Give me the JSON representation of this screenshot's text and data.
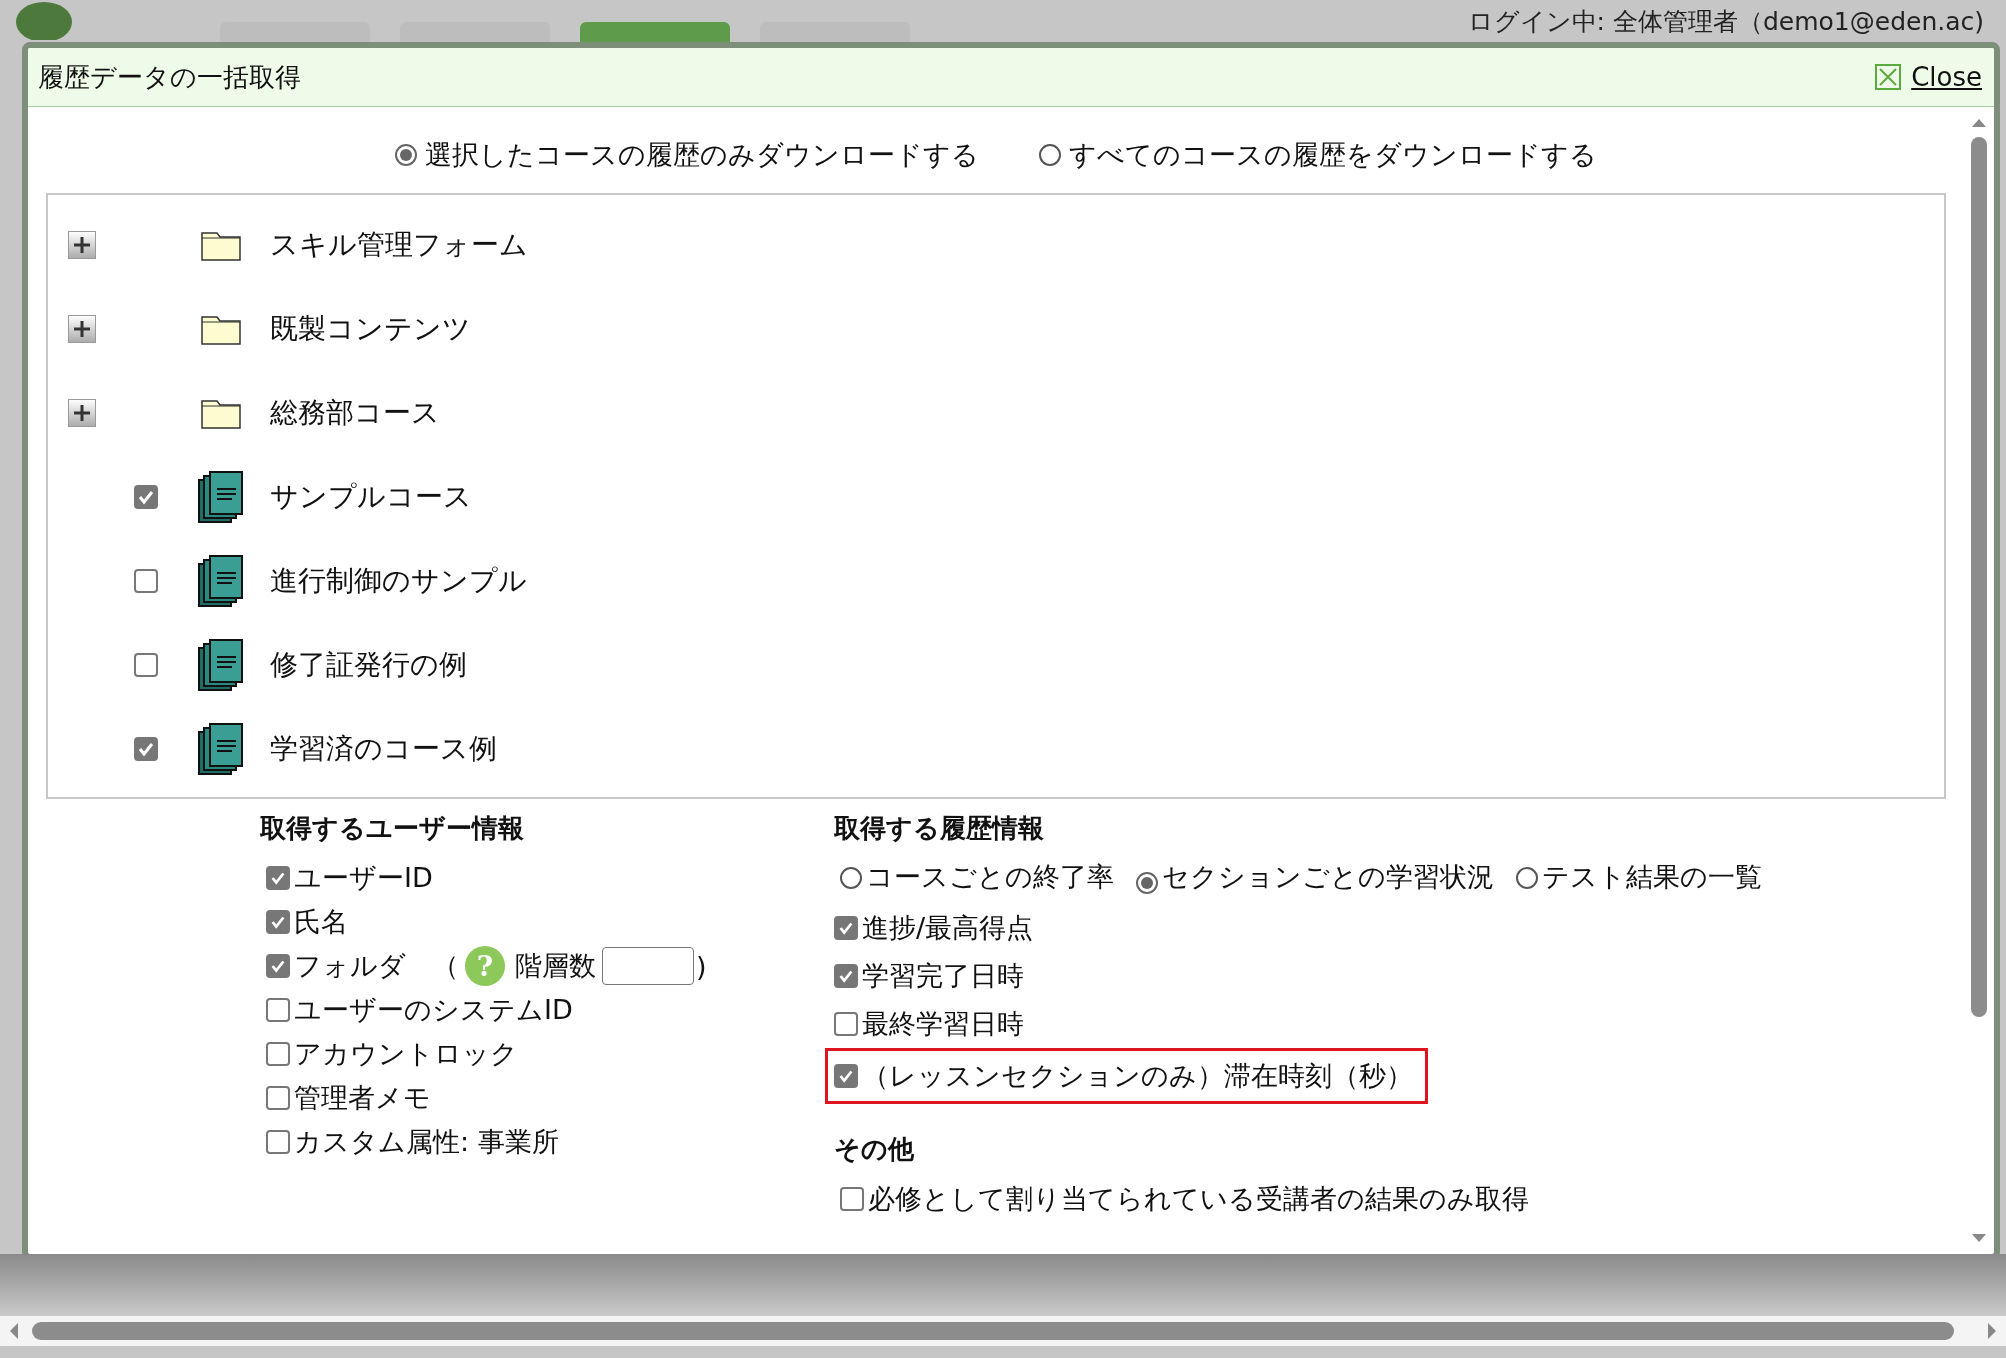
{
  "header": {
    "login": "ログイン中: 全体管理者（demo1@eden.ac)"
  },
  "nav_tabs": [
    {
      "selected": false
    },
    {
      "selected": false
    },
    {
      "selected": true
    },
    {
      "selected": false
    }
  ],
  "dialog": {
    "title": "履歴データの一括取得",
    "close": "Close",
    "scope": [
      {
        "label": "選択したコースの履歴のみダウンロードする",
        "selected": true
      },
      {
        "label": "すべてのコースの履歴をダウンロードする",
        "selected": false
      }
    ],
    "tree": [
      {
        "kind": "folder",
        "label": "スキル管理フォーム",
        "expanded": false
      },
      {
        "kind": "folder",
        "label": "既製コンテンツ",
        "expanded": false
      },
      {
        "kind": "folder",
        "label": "総務部コース",
        "expanded": false
      },
      {
        "kind": "course",
        "label": "サンプルコース",
        "checked": true
      },
      {
        "kind": "course",
        "label": "進行制御のサンプル",
        "checked": false
      },
      {
        "kind": "course",
        "label": "修了証発行の例",
        "checked": false
      },
      {
        "kind": "course",
        "label": "学習済のコース例",
        "checked": true
      }
    ],
    "user_info": {
      "heading": "取得するユーザー情報",
      "items": [
        {
          "kind": "plain",
          "label": "ユーザーID",
          "checked": true
        },
        {
          "kind": "plain",
          "label": "氏名",
          "checked": true
        },
        {
          "kind": "depth",
          "label": "フォルダ",
          "checked": true,
          "open_paren": "（",
          "help": "?",
          "depth_label": "階層数",
          "close_paren": ")"
        },
        {
          "kind": "plain",
          "label": "ユーザーのシステムID",
          "checked": false
        },
        {
          "kind": "plain",
          "label": "アカウントロック",
          "checked": false
        },
        {
          "kind": "plain",
          "label": "管理者メモ",
          "checked": false
        },
        {
          "kind": "plain",
          "label": "カスタム属性: 事業所",
          "checked": false
        }
      ]
    },
    "history_info": {
      "heading": "取得する履歴情報",
      "modes": [
        {
          "label": "コースごとの終了率",
          "selected": false
        },
        {
          "label": "セクションごとの学習状況",
          "selected": true
        },
        {
          "label": "テスト結果の一覧",
          "selected": false
        }
      ],
      "items": [
        {
          "label": "進捗/最高得点",
          "checked": true,
          "highlighted": false
        },
        {
          "label": "学習完了日時",
          "checked": true,
          "highlighted": false
        },
        {
          "label": "最終学習日時",
          "checked": false,
          "highlighted": false
        },
        {
          "label": "（レッスンセクションのみ）滞在時刻（秒）",
          "checked": true,
          "highlighted": true
        }
      ]
    },
    "other": {
      "heading": "その他",
      "items": [
        {
          "label": "必修として割り当てられている受講者の結果のみ取得",
          "checked": false
        }
      ]
    }
  }
}
